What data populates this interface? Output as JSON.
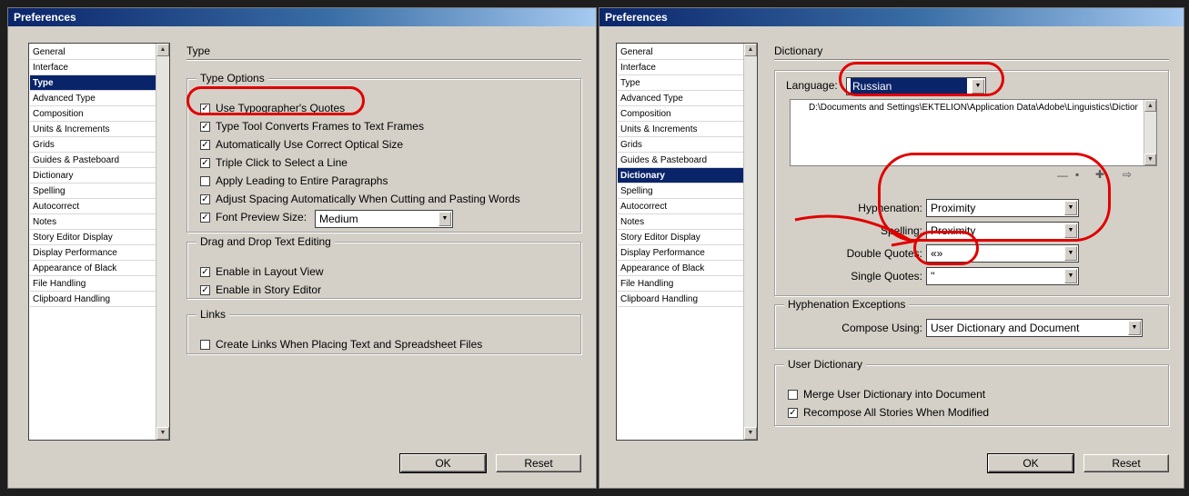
{
  "left": {
    "title": "Preferences",
    "categories": [
      "General",
      "Interface",
      "Type",
      "Advanced Type",
      "Composition",
      "Units & Increments",
      "Grids",
      "Guides & Pasteboard",
      "Dictionary",
      "Spelling",
      "Autocorrect",
      "Notes",
      "Story Editor Display",
      "Display Performance",
      "Appearance of Black",
      "File Handling",
      "Clipboard Handling"
    ],
    "selected_index": 2,
    "section_title": "Type",
    "type_options": {
      "legend": "Type Options",
      "items": [
        {
          "label": "Use Typographer's Quotes",
          "checked": true
        },
        {
          "label": "Type Tool Converts Frames to Text Frames",
          "checked": true
        },
        {
          "label": "Automatically Use Correct Optical Size",
          "checked": true
        },
        {
          "label": "Triple Click to Select a Line",
          "checked": true
        },
        {
          "label": "Apply Leading to Entire Paragraphs",
          "checked": false
        },
        {
          "label": "Adjust Spacing Automatically When Cutting and Pasting Words",
          "checked": true
        },
        {
          "label": "Font Preview Size:",
          "checked": true
        }
      ],
      "font_preview_size": "Medium"
    },
    "drag_drop": {
      "legend": "Drag and Drop Text Editing",
      "items": [
        {
          "label": "Enable in Layout View",
          "checked": true
        },
        {
          "label": "Enable in Story Editor",
          "checked": true
        }
      ]
    },
    "links": {
      "legend": "Links",
      "items": [
        {
          "label": "Create Links When Placing Text and Spreadsheet Files",
          "checked": false
        }
      ]
    },
    "ok_label": "OK",
    "reset_label": "Reset"
  },
  "right": {
    "title": "Preferences",
    "categories": [
      "General",
      "Interface",
      "Type",
      "Advanced Type",
      "Composition",
      "Units & Increments",
      "Grids",
      "Guides & Pasteboard",
      "Dictionary",
      "Spelling",
      "Autocorrect",
      "Notes",
      "Story Editor Display",
      "Display Performance",
      "Appearance of Black",
      "File Handling",
      "Clipboard Handling"
    ],
    "selected_index": 8,
    "section_title": "Dictionary",
    "language_label": "Language:",
    "language_value": "Russian",
    "dictionary_path": "D:\\Documents and Settings\\EKTELION\\Application Data\\Adobe\\Linguistics\\Dictionaries\\A",
    "hyphenation_label": "Hyphenation:",
    "hyphenation_value": "Proximity",
    "spelling_label": "Spelling:",
    "spelling_value": "Proximity",
    "double_quotes_label": "Double Quotes:",
    "double_quotes_value": "«»",
    "single_quotes_label": "Single Quotes:",
    "single_quotes_value": "''",
    "hyphenation_exceptions": {
      "legend": "Hyphenation Exceptions",
      "compose_label": "Compose Using:",
      "compose_value": "User Dictionary and Document"
    },
    "user_dictionary": {
      "legend": "User Dictionary",
      "items": [
        {
          "label": "Merge User Dictionary into Document",
          "checked": false
        },
        {
          "label": "Recompose All Stories When Modified",
          "checked": true
        }
      ]
    },
    "ok_label": "OK",
    "reset_label": "Reset"
  },
  "colors": {
    "dialog_bg": "#d4d0c8",
    "selection": "#0a246a",
    "annotation": "#e00000"
  }
}
